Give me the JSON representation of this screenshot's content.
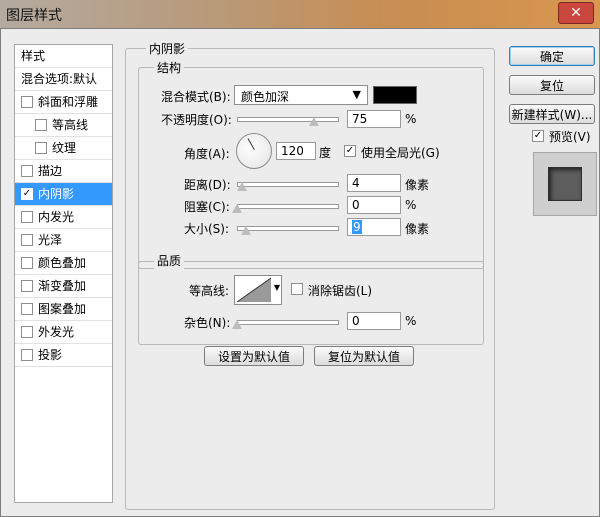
{
  "window": {
    "title": "图层样式",
    "close_glyph": "✕"
  },
  "styles_panel": {
    "header": "样式",
    "blend_options": "混合选项:默认",
    "items": [
      {
        "label": "斜面和浮雕",
        "checked": false
      },
      {
        "label": "等高线",
        "checked": false
      },
      {
        "label": "纹理",
        "checked": false
      },
      {
        "label": "描边",
        "checked": false
      },
      {
        "label": "内阴影",
        "checked": true
      },
      {
        "label": "内发光",
        "checked": false
      },
      {
        "label": "光泽",
        "checked": false
      },
      {
        "label": "颜色叠加",
        "checked": false
      },
      {
        "label": "渐变叠加",
        "checked": false
      },
      {
        "label": "图案叠加",
        "checked": false
      },
      {
        "label": "外发光",
        "checked": false
      },
      {
        "label": "投影",
        "checked": false
      }
    ],
    "check_glyph": "✓"
  },
  "inner_shadow": {
    "title": "内阴影",
    "structure": {
      "title": "结构",
      "blend_mode_label": "混合模式(B):",
      "blend_mode_value": "颜色加深",
      "blend_color": "#000000",
      "opacity_label": "不透明度(O):",
      "opacity_value": "75",
      "opacity_unit": "%",
      "opacity_level": 0.75,
      "angle_label": "角度(A):",
      "angle_value": "120",
      "angle_unit": "度",
      "global_light_label": "使用全局光(G)",
      "global_light_checked": true,
      "distance_label": "距离(D):",
      "distance_value": "4",
      "distance_unit": "像素",
      "choke_label": "阻塞(C):",
      "choke_value": "0",
      "choke_unit": "%",
      "size_label": "大小(S):",
      "size_value": "9",
      "size_unit": "像素"
    },
    "quality": {
      "title": "品质",
      "contour_label": "等高线:",
      "antialias_label": "消除锯齿(L)",
      "antialias_checked": false,
      "noise_label": "杂色(N):",
      "noise_value": "0",
      "noise_unit": "%"
    },
    "set_default_label": "设置为默认值",
    "reset_default_label": "复位为默认值"
  },
  "actions": {
    "ok_label": "确定",
    "reset_label": "复位",
    "new_style_label": "新建样式(W)...",
    "preview_label": "预览(V)",
    "preview_checked": true
  }
}
